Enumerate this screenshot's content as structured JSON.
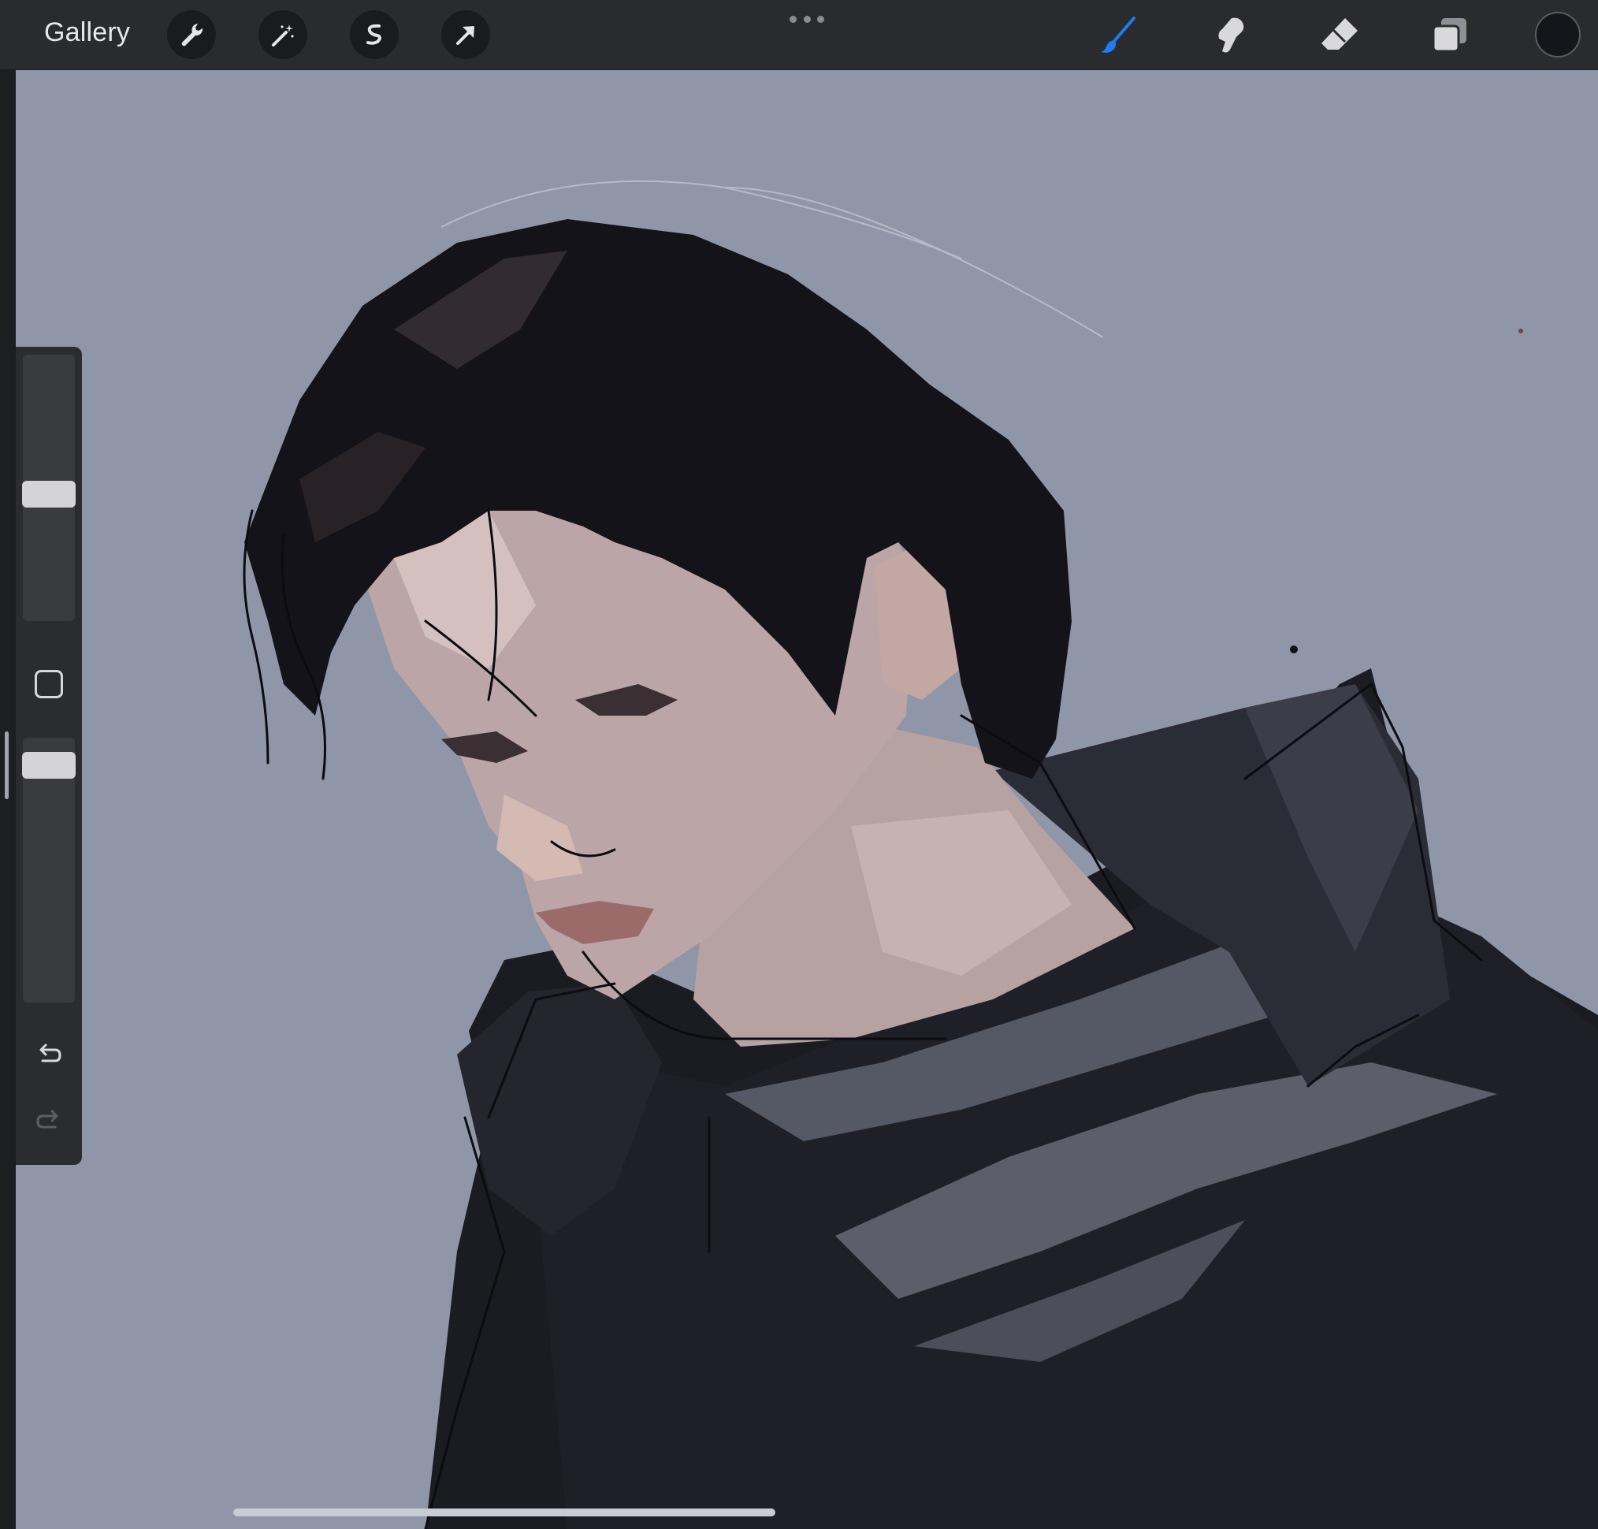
{
  "toolbar": {
    "gallery_label": "Gallery",
    "left_tools": [
      "wrench-icon",
      "magic-wand-icon",
      "selection-icon",
      "transform-arrow-icon"
    ],
    "right_tools": [
      "brush-icon",
      "smudge-icon",
      "eraser-icon",
      "layers-icon",
      "color-swatch"
    ]
  },
  "colors": {
    "toolbar_bg": "#2a2b2e",
    "canvas_bg": "#8e96a8",
    "active_brush": "#1f7cf2",
    "current_color": "#15161b"
  },
  "sidebar": {
    "brush_size_level": 0.46,
    "opacity_level": 0.05
  }
}
